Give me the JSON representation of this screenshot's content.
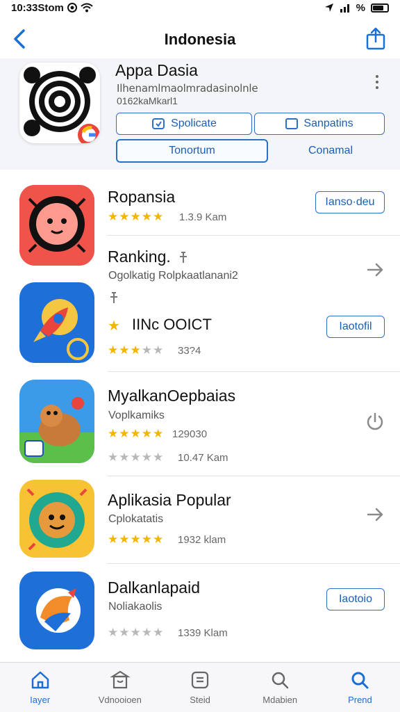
{
  "status_bar": {
    "time_text": "10:33Stom",
    "battery_text": "%"
  },
  "nav": {
    "title": "Indonesia"
  },
  "featured": {
    "title": "Appa Dasia",
    "subtitle_line1": "Ilhenamlmaolmradasinolnle",
    "subtitle_line2": "0162kaMkarl1",
    "btn_spolicate": "Spolicate",
    "btn_sanpatins": "Sanpatins",
    "btn_tonortum": "Tonortum",
    "link_conamal": "Conamal"
  },
  "apps": [
    {
      "name": "Ropansia",
      "stars_text": "★★★★★",
      "meta": "1.3.9 Kam",
      "action_label": "Ianso·deu"
    },
    {
      "name": "Ranking.",
      "subtitle": "Ogolkatig Rolpkaatlanani2",
      "special_label": "IINc OOICT",
      "meta": "33?4",
      "action_label": "Iaotofil"
    },
    {
      "name": "MyalkanOepbaias",
      "subtitle": "Voplkamiks",
      "meta_count": "129030",
      "meta": "10.47 Kam"
    },
    {
      "name": "Aplikasia Popular",
      "subtitle": "Cplokatatis",
      "meta": "1932 klam"
    },
    {
      "name": "Dalkanlapaid",
      "subtitle": "Noliakaolis",
      "meta": "1339 Klam",
      "action_label": "Iaotoio"
    }
  ],
  "tabs": [
    {
      "label": "Iayer",
      "icon": "home-icon",
      "active": true
    },
    {
      "label": "Vdnooioen",
      "icon": "store-icon",
      "active": false
    },
    {
      "label": "Steid",
      "icon": "document-icon",
      "active": false
    },
    {
      "label": "Mdabien",
      "icon": "search-icon",
      "active": false
    },
    {
      "label": "Prend",
      "icon": "search-icon",
      "active": true
    }
  ],
  "colors": {
    "accent": "#1a6fd6",
    "star": "#f5b400",
    "star_off": "#b8b8b8"
  }
}
